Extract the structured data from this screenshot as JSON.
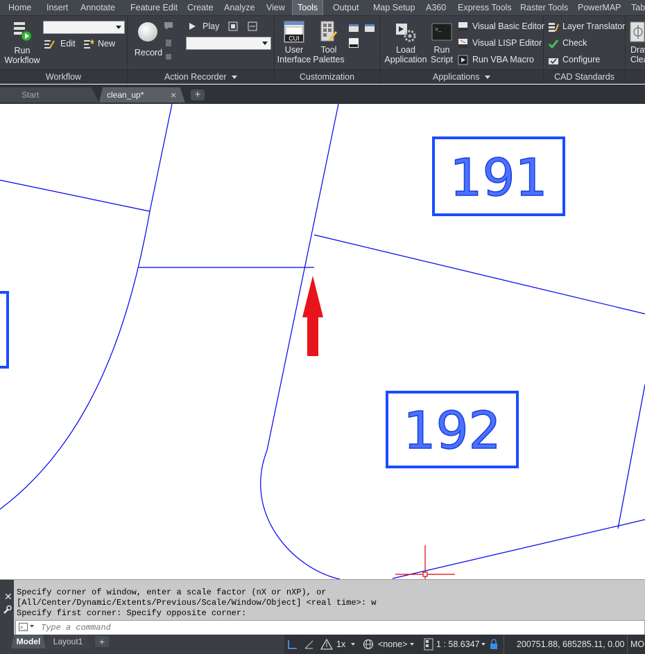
{
  "menu": {
    "tabs": [
      "Home",
      "Insert",
      "Annotate",
      "Feature Edit",
      "Create",
      "Analyze",
      "View",
      "Tools",
      "Output",
      "Map Setup",
      "A360",
      "Express Tools",
      "Raster Tools",
      "PowerMAP",
      "Tab"
    ],
    "active": "Tools"
  },
  "ribbon": {
    "workflow": {
      "title": "Workflow",
      "run_workflow_line1": "Run",
      "run_workflow_line2": "Workflow",
      "edit": "Edit",
      "new": "New"
    },
    "action_recorder": {
      "title": "Action Recorder",
      "record": "Record",
      "play": "Play"
    },
    "customization": {
      "title": "Customization",
      "user_interface_line1": "User",
      "user_interface_line2": "Interface",
      "tool_palettes_line1": "Tool",
      "tool_palettes_line2": "Palettes",
      "cui_badge": "CUI"
    },
    "applications": {
      "title": "Applications",
      "load_application_line1": "Load",
      "load_application_line2": "Application",
      "run_script_line1": "Run",
      "run_script_line2": "Script",
      "visual_basic_editor": "Visual Basic Editor",
      "visual_lisp_editor": "Visual LISP Editor",
      "run_vba_macro": "Run VBA Macro"
    },
    "cad_standards": {
      "title": "CAD Standards",
      "layer_translator": "Layer Translator",
      "check": "Check",
      "configure": "Configure"
    },
    "drawing_cleanup": {
      "line1": "Draw",
      "line2": "Clea"
    }
  },
  "file_tabs": {
    "start": "Start",
    "clean_up": "clean_up*"
  },
  "drawing": {
    "parcel_191": "191",
    "parcel_192": "192"
  },
  "command": {
    "line1": "Specify corner of window, enter a scale factor (nX or nXP), or",
    "line2": "[All/Center/Dynamic/Extents/Previous/Scale/Window/Object] <real time>: w",
    "line3": "Specify first corner: Specify opposite corner:",
    "placeholder": "Type a command"
  },
  "status_bar": {
    "model_tab": "Model",
    "layout_tab": "Layout1",
    "annotation_scale": "1x",
    "coordinate_system": "<none>",
    "scale": "1 : 58.6347",
    "coordinates": "200751.88, 685285.11, 0.00",
    "mode": "MO"
  },
  "colors": {
    "menubar": "#42464d",
    "ribbon": "#3b3f45",
    "geometry": "#0000ee",
    "label_box": "#1a4dff",
    "arrow": "#e8141c",
    "crosshair": "#e00000"
  }
}
